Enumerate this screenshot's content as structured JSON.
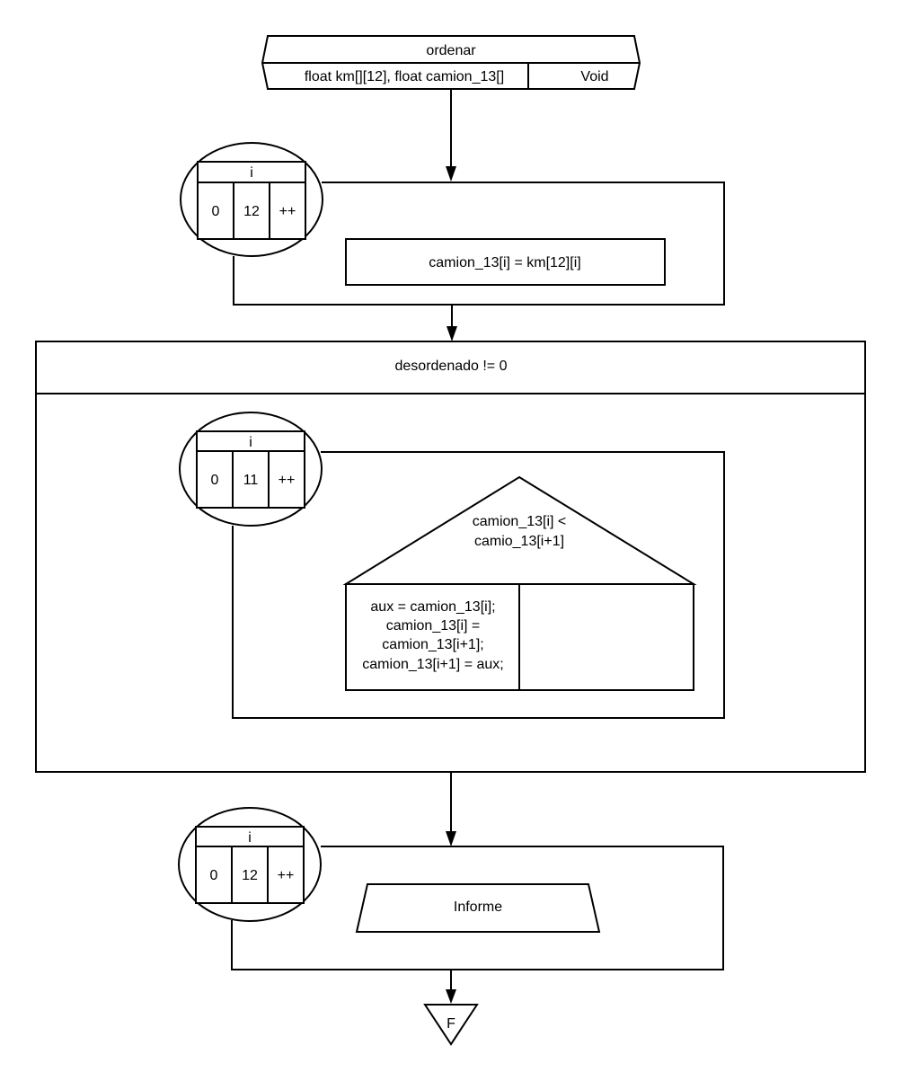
{
  "header": {
    "name": "ordenar",
    "params": "float km[][12], float camion_13[]",
    "return_type": "Void"
  },
  "loop1": {
    "var": "i",
    "start": "0",
    "end": "12",
    "step": "++",
    "body": "camion_13[i] = km[12][i]"
  },
  "while": {
    "condition": "desordenado != 0"
  },
  "loop2": {
    "var": "i",
    "start": "0",
    "end": "11",
    "step": "++",
    "if": {
      "condition_line1": "camion_13[i] <",
      "condition_line2": "camio_13[i+1]",
      "true_branch": [
        "aux = camion_13[i];",
        "camion_13[i] =",
        "camion_13[i+1];",
        "camion_13[i+1] = aux;"
      ]
    }
  },
  "loop3": {
    "var": "i",
    "start": "0",
    "end": "12",
    "step": "++",
    "body": "Informe"
  },
  "end": {
    "label": "F"
  }
}
